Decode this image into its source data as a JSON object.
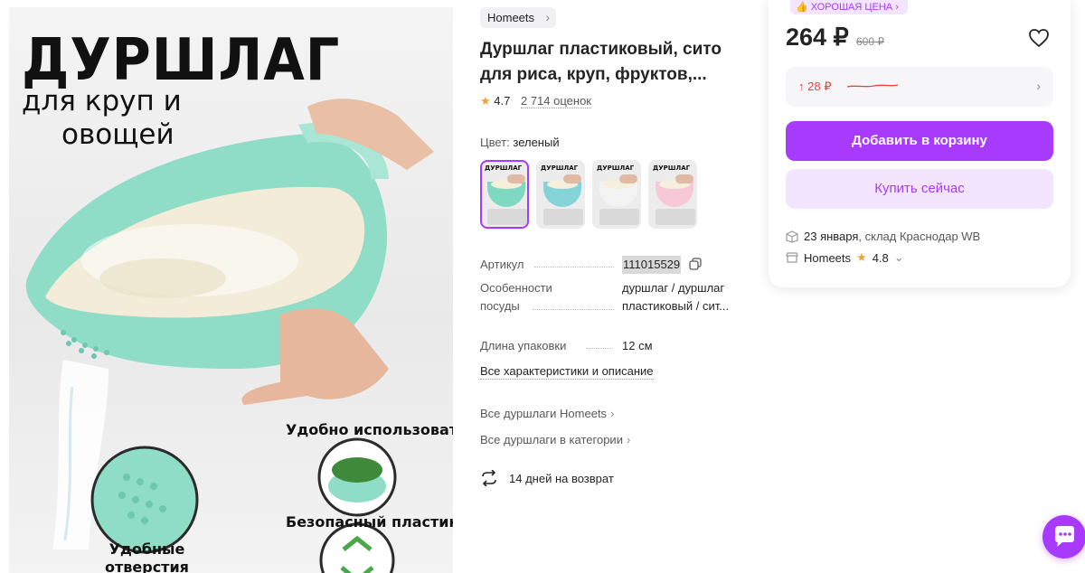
{
  "image": {
    "title": "ДУРШЛАГ",
    "subtitle_line1": "для круп и",
    "subtitle_line2": "овощей",
    "feature1": "Удобно использовать",
    "feature2": "Безопасный пластик",
    "feature3": "Удобные\nотверстия"
  },
  "product": {
    "brand": "Homeets",
    "title": "Дуршлаг пластиковый, сито для риса, круп, фруктов,...",
    "rating": "4.7",
    "reviews": "2 714 оценок",
    "color_label": "Цвет:",
    "color_value": "зеленый",
    "thumbs": [
      {
        "label": "ДУРШЛАГ",
        "color": "#7fd8c2",
        "active": true
      },
      {
        "label": "ДУРШЛАГ",
        "color": "#83d3d8",
        "active": false
      },
      {
        "label": "ДУРШЛАГ",
        "color": "#f3f3f3",
        "active": false
      },
      {
        "label": "ДУРШЛАГ",
        "color": "#f7c9d6",
        "active": false
      }
    ]
  },
  "specs": {
    "article_key": "Артикул",
    "article_val": "111015529",
    "features_key": "Особенности посуды",
    "features_val": "дуршлаг / дуршлаг пластиковый / сит...",
    "length_key": "Длина упаковки",
    "length_val": "12 см",
    "all_link": "Все характеристики и описание"
  },
  "links": {
    "brand_all": "Все дуршлаги Homeets",
    "category_all": "Все дуршлаги в категории",
    "returns": "14 дней на возврат"
  },
  "card": {
    "badge": "ХОРОШАЯ ЦЕНА",
    "price": "264 ₽",
    "old_price": "600 ₽",
    "price_change": "28 ₽",
    "add_to_cart": "Добавить в корзину",
    "buy_now": "Купить сейчас",
    "delivery_date": "23 января",
    "delivery_rest": ", склад Краснодар WB",
    "seller": "Homeets",
    "seller_rating": "4.8"
  },
  "colors": {
    "accent": "#a73afd",
    "accent_light": "#f3e5ff",
    "price_up": "#f03e3e",
    "star": "#f1a33a"
  }
}
